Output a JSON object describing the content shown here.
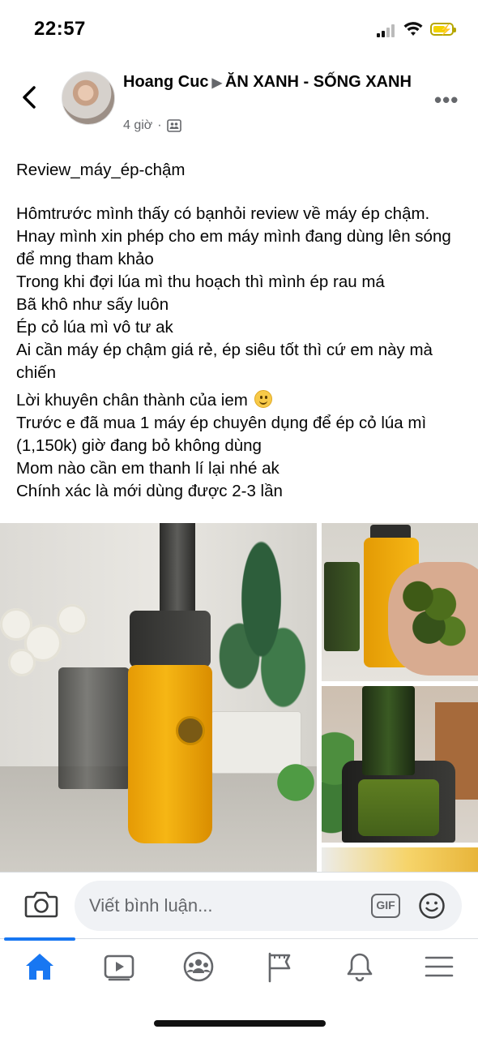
{
  "status_bar": {
    "time": "22:57"
  },
  "post": {
    "author": "Hoang Cuc",
    "group": "ĂN XANH - SỐNG XANH",
    "time_ago": "4 giờ",
    "separator": "·",
    "text_lines": [
      "Review_máy_ép-chậm",
      "",
      "Hômtrước mình thấy có bạnhỏi review về máy ép chậm. Hnay mình xin phép cho em máy mình đang dùng lên sóng để mng tham khảo",
      "Trong khi đợi lúa mì thu hoạch thì mình ép rau má",
      "Bã khô như sấy luôn",
      "Ép cỏ lúa mì vô tư ak",
      "Ai cần máy ép chậm giá rẻ, ép siêu tốt thì cứ em này mà chiến",
      "Lời khuyên chân thành của iem",
      "Trước e đã mua 1 máy ép chuyên dụng để ép cỏ lúa mì (1,150k) giờ đang bỏ không dùng",
      "Mom nào cần em thanh lí lại nhé ak",
      "Chính xác là mới dùng được 2-3 lần"
    ]
  },
  "comment_bar": {
    "placeholder": "Viết bình luận...",
    "gif_label": "GIF"
  },
  "nav": {
    "items": [
      "home-icon",
      "video-icon",
      "groups-icon",
      "pages-flag-icon",
      "notifications-bell-icon",
      "menu-icon"
    ],
    "active_color": "#1877f2",
    "inactive_color": "#65676b"
  },
  "colors": {
    "accent": "#1877f2",
    "secondary_text": "#65676b",
    "input_bg": "#f0f2f5"
  }
}
